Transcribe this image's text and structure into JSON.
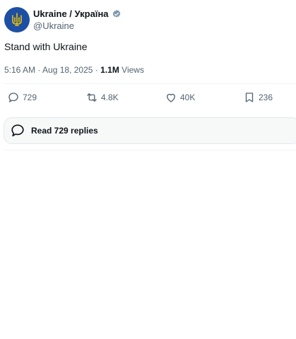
{
  "account": {
    "display_name": "Ukraine / Україна",
    "handle": "@Ukraine",
    "verified_icon": "verified-badge-icon",
    "avatar_bg": "#1d4fa3",
    "avatar_emblem": "trident-icon",
    "emblem_color": "#f2c200"
  },
  "tweet": {
    "text": "Stand with Ukraine",
    "time": "5:16 AM",
    "separator": "·",
    "date": "Aug 18, 2025",
    "views_count": "1.1M",
    "views_label": "Views"
  },
  "actions": {
    "replies": "729",
    "reposts": "4.8K",
    "likes": "40K",
    "bookmarks": "236"
  },
  "replies_button": {
    "label": "Read 729 replies"
  }
}
